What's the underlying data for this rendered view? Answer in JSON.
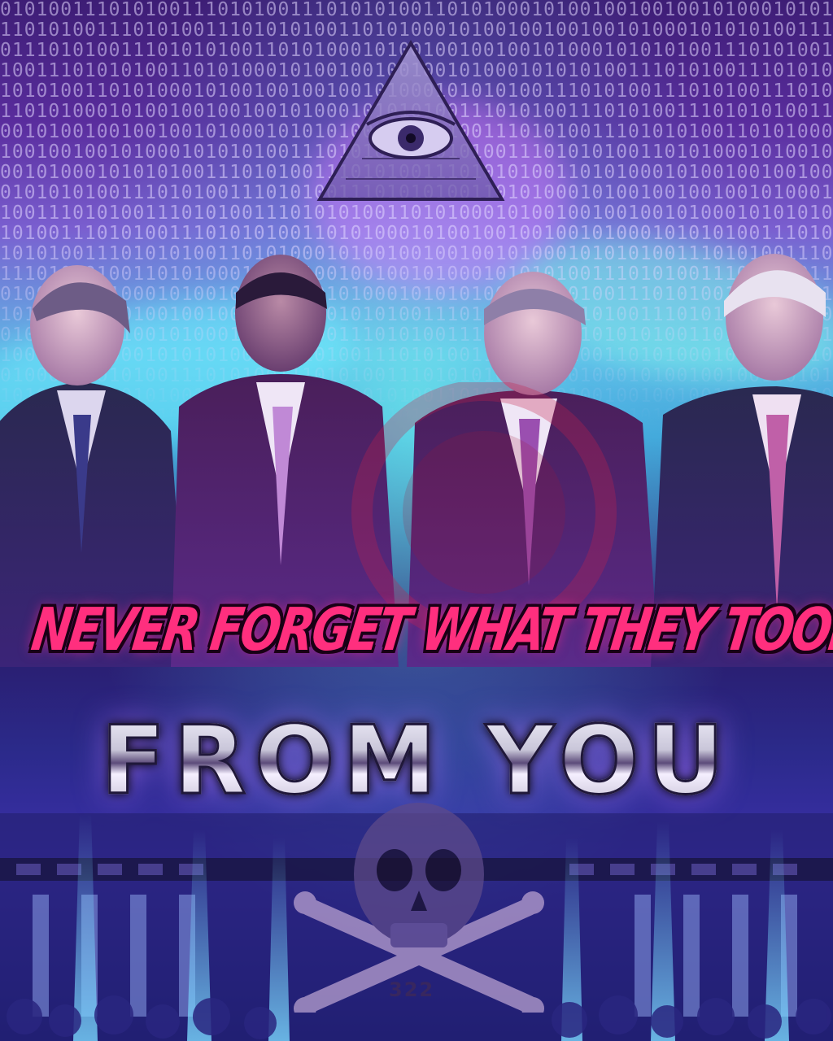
{
  "poster": {
    "headline": "NEVER FORGET WHAT THEY TOOK",
    "subhead": "FROM YOU",
    "skull_number": "322"
  },
  "colors": {
    "headline": "#ff2f7e",
    "accent_cyan": "#5fe0e6",
    "accent_purple": "#7a5fd0",
    "deep_blue": "#2b2a8a"
  },
  "icons": {
    "pyramid": "eye-of-providence-icon",
    "skull": "skull-and-bones-icon"
  }
}
